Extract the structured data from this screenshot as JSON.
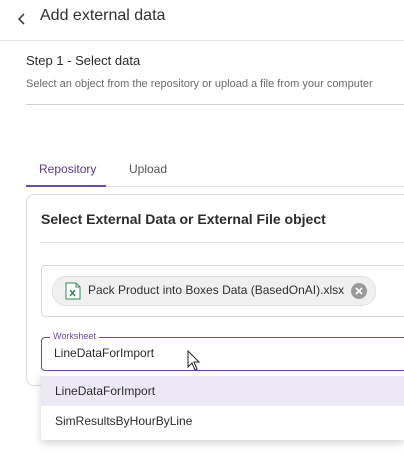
{
  "header": {
    "title": "Add external data"
  },
  "step": {
    "title": "Step 1 - Select data",
    "description": "Select an object from the repository or upload a file from your computer"
  },
  "tabs": [
    {
      "label": "Repository",
      "active": true
    },
    {
      "label": "Upload",
      "active": false
    }
  ],
  "card": {
    "title": "Select External Data or External File object",
    "selected_file": "Pack Product into Boxes Data (BasedOnAI).xlsx"
  },
  "worksheet": {
    "label": "Worksheet",
    "value": "LineDataForImport",
    "options": [
      "LineDataForImport",
      "SimResultsByHourByLine"
    ]
  },
  "colors": {
    "accent": "#6a4ba0",
    "active_tab_text": "#5a3b8c",
    "highlight_option": "#ece8f5",
    "excel_icon_green": "#2e8b57"
  }
}
